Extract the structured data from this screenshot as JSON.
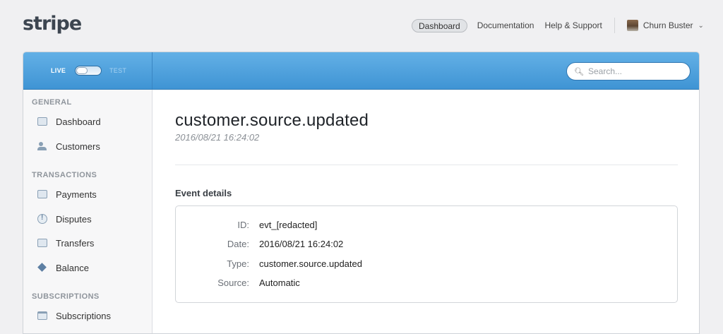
{
  "brand": {
    "logo_text": "stripe"
  },
  "topnav": {
    "dashboard": "Dashboard",
    "documentation": "Documentation",
    "help": "Help & Support",
    "account": "Churn Buster"
  },
  "header": {
    "live_label": "LIVE",
    "test_label": "TEST",
    "search_placeholder": "Search..."
  },
  "sidebar": {
    "sections": [
      {
        "title": "GENERAL",
        "items": [
          {
            "label": "Dashboard",
            "icon": "chart-icon"
          },
          {
            "label": "Customers",
            "icon": "people-icon"
          }
        ]
      },
      {
        "title": "TRANSACTIONS",
        "items": [
          {
            "label": "Payments",
            "icon": "card-icon"
          },
          {
            "label": "Disputes",
            "icon": "alert-icon"
          },
          {
            "label": "Transfers",
            "icon": "transfer-icon"
          },
          {
            "label": "Balance",
            "icon": "balance-icon"
          }
        ]
      },
      {
        "title": "SUBSCRIPTIONS",
        "items": [
          {
            "label": "Subscriptions",
            "icon": "calendar-icon"
          }
        ]
      }
    ]
  },
  "event": {
    "title": "customer.source.updated",
    "timestamp": "2016/08/21 16:24:02",
    "details_heading": "Event details",
    "details": [
      {
        "key": "ID:",
        "value": "evt_[redacted]"
      },
      {
        "key": "Date:",
        "value": "2016/08/21 16:24:02"
      },
      {
        "key": "Type:",
        "value": "customer.source.updated"
      },
      {
        "key": "Source:",
        "value": "Automatic"
      }
    ]
  },
  "colors": {
    "header_blue": "#3f94d4",
    "logo": "#3c4550"
  }
}
